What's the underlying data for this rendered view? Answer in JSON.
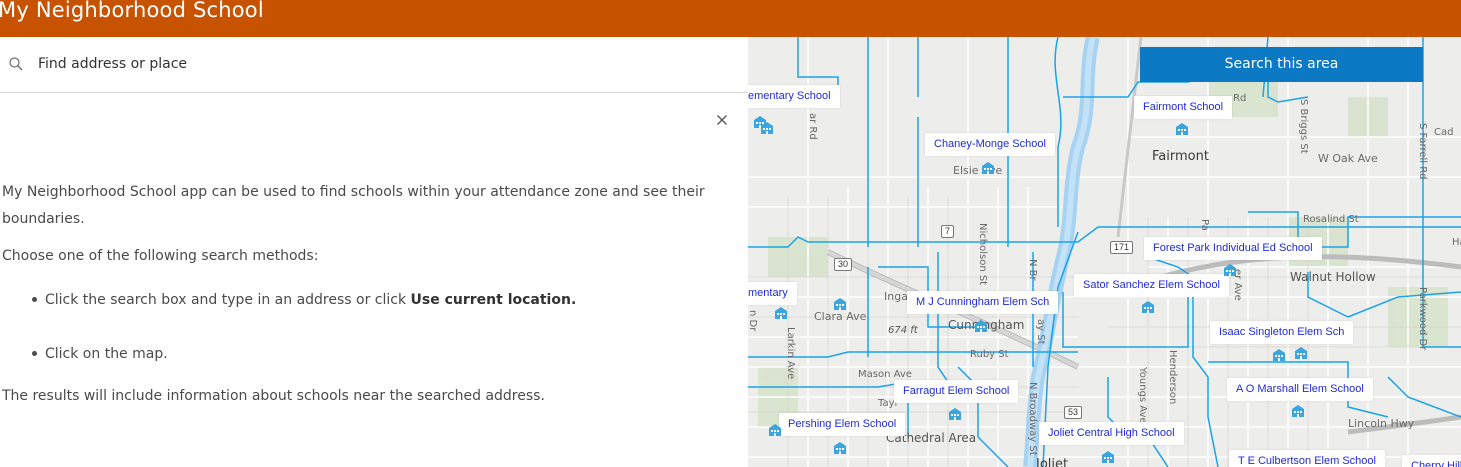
{
  "header": {
    "title": "My Neighborhood School"
  },
  "search": {
    "placeholder": "Find address or place"
  },
  "info": {
    "intro": "My Neighborhood School app can be used to find schools within your attendance zone and see their boundaries.",
    "choose": "Choose one of the following search methods:",
    "bullet1_text": "Click the search box and type in an address or click ",
    "bullet1_bold": "Use current location.",
    "bullet2": "Click on the map.",
    "results": "The results will include information about schools near the searched address."
  },
  "map": {
    "search_area_button": "Search this area",
    "schools": [
      "ementary School",
      "Fairmont School",
      "Chaney-Monge School",
      "Forest Park Individual Ed School",
      "Sator Sanchez Elem School",
      "mentary",
      "M J Cunningham Elem Sch",
      "Isaac Singleton Elem Sch",
      "A O Marshall Elem School",
      "Farragut Elem School",
      "Pershing Elem School",
      "Joliet Central High School",
      "T E Culbertson Elem School",
      "Cherry Hill"
    ],
    "places": {
      "fairmont": "Fairmont",
      "cunningham": "Cunningham",
      "walnut_hollow": "Walnut Hollow",
      "cathedral_area": "Cathedral Area",
      "joliet": "Joliet",
      "elevation": "674 ft"
    },
    "streets": {
      "elsie": "Elsie Ave",
      "w_oak": "W Oak Ave",
      "rosalind": "Rosalind St",
      "clara": "Clara Ave",
      "ruby": "Ruby St",
      "mason": "Mason Ave",
      "inga": "Inga",
      "lincoln": "Lincoln Hwy",
      "taylor": "Tayl",
      "briggs": "S Briggs St",
      "farrell": "S Farrell Rd",
      "nicholson": "Nicholson St",
      "n_broadway": "N Broadway St",
      "henderson": "Henderson",
      "youngs": "Youngs Ave",
      "larkin": "Larkin Ave",
      "parkwood": "Parkwood Dr",
      "rd": "Rd",
      "cad": "Cad",
      "ha": "Ha",
      "n_br": "N Br",
      "ay_st": "ay St",
      "er_ave": "er Ave",
      "ar_rd": "ar Rd",
      "n_dr": "n Dr",
      "pa": "Pa"
    },
    "shields": {
      "r7": "7",
      "r30": "30",
      "r171": "171",
      "r53": "53"
    }
  },
  "colors": {
    "header": "#c75300",
    "search_area_button": "#0b79c4",
    "boundary": "#1aa3e8",
    "school_label_text": "#1f2bd6",
    "river": "#a7d3f3"
  }
}
